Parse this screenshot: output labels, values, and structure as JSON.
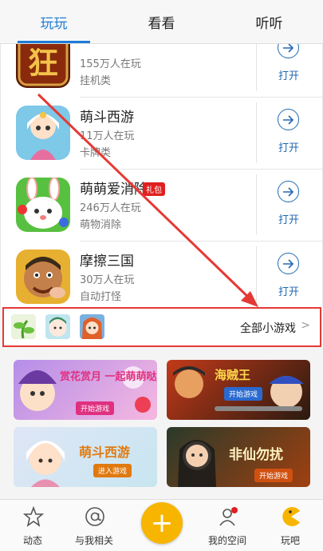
{
  "tabs": {
    "play": "玩玩",
    "watch": "看看",
    "listen": "听听"
  },
  "games": [
    {
      "title": "",
      "players": "155万人在玩",
      "category": "挂机类",
      "open": "打开"
    },
    {
      "title": "萌斗西游",
      "players": "11万人在玩",
      "category": "卡牌类",
      "open": "打开"
    },
    {
      "title": "萌萌爱消除",
      "badge": "礼包",
      "players": "246万人在玩",
      "category": "萌物消除",
      "open": "打开"
    },
    {
      "title": "摩擦三国",
      "players": "30万人在玩",
      "category": "自动打怪",
      "open": "打开"
    }
  ],
  "all_games": {
    "label": "全部小游戏",
    "chevron": ">"
  },
  "banners": [
    {
      "text": "赏花赏月 一起萌萌哒",
      "button": "开始游戏"
    },
    {
      "text": "海贼王",
      "button": "开始游戏"
    },
    {
      "text": "萌斗西游",
      "button": "进入游戏"
    },
    {
      "text": "非仙勿扰",
      "button": "开始游戏"
    }
  ],
  "bottom_nav": {
    "feed": "动态",
    "mentions": "与我相关",
    "add": "+",
    "space": "我的空间",
    "play": "玩吧"
  },
  "colors": {
    "accent": "#1e7bd6",
    "open": "#2369b3",
    "highlight": "#e53935",
    "fab": "#f7b500",
    "badge": "#e02020"
  }
}
